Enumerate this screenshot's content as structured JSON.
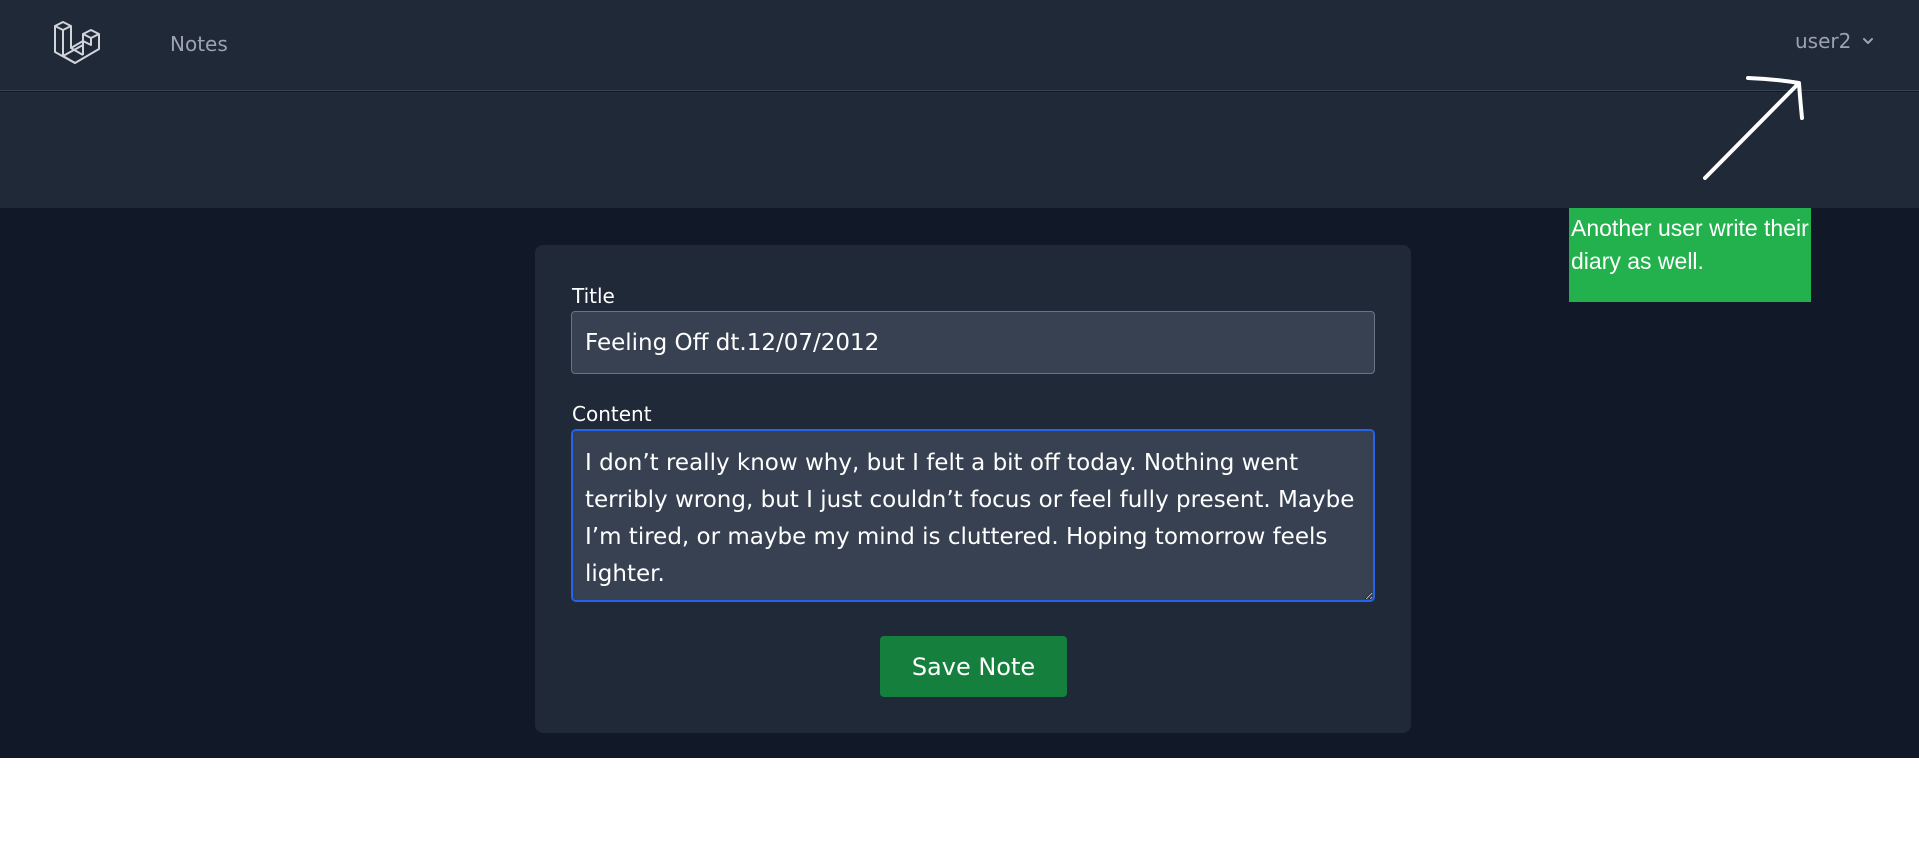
{
  "nav": {
    "logo_icon": "laravel-logo-icon",
    "links": [
      "Notes"
    ],
    "user": {
      "name": "user2",
      "chevron_icon": "chevron-down-icon"
    }
  },
  "form": {
    "title_label": "Title",
    "title_value": "Feeling Off dt.12/07/2012",
    "content_label": "Content",
    "content_value": "I don’t really know why, but I felt a bit off today. Nothing went terribly wrong, but I just couldn’t focus or feel fully present. Maybe I’m tired, or maybe my mind is cluttered. Hoping tomorrow feels lighter.",
    "save_label": "Save Note"
  },
  "annotation": {
    "text": "Another user write their diary as well.",
    "note_color": "#22b14c",
    "arrow_icon": "arrow-up-right-icon"
  },
  "colors": {
    "page_bg": "#111827",
    "nav_bg": "#1f2937",
    "input_bg": "#374151",
    "focus_border": "#2563eb",
    "button_bg": "#15803d",
    "muted_text": "#9ca3af"
  }
}
